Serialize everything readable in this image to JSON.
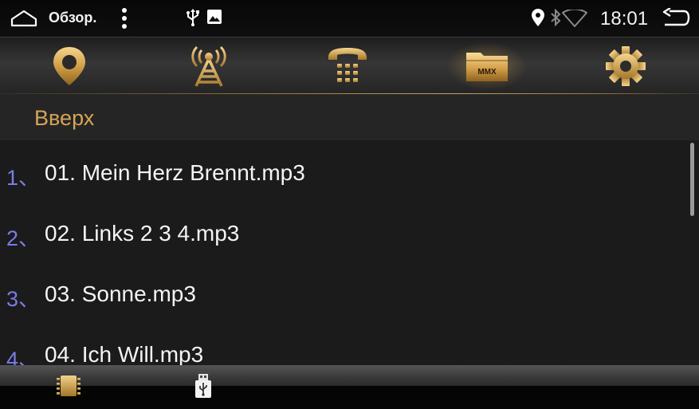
{
  "statusbar": {
    "title": "Обзор.",
    "time": "18:01",
    "icons": [
      "home-outline-icon",
      "more-vert-icon",
      "usb-icon",
      "image-icon",
      "location-icon",
      "bluetooth-icon",
      "wifi-icon",
      "back-icon"
    ]
  },
  "tabs": [
    {
      "name": "navigation",
      "icon": "map-pin-icon",
      "active": false
    },
    {
      "name": "radio",
      "icon": "radio-tower-icon",
      "active": false
    },
    {
      "name": "phone",
      "icon": "phone-icon",
      "active": false
    },
    {
      "name": "media",
      "icon": "folder-icon",
      "label": "MMX",
      "active": true
    },
    {
      "name": "settings",
      "icon": "gear-icon",
      "active": false
    }
  ],
  "list": {
    "up_label": "Вверх",
    "items": [
      {
        "index": "1、",
        "name": "01. Mein Herz Brennt.mp3"
      },
      {
        "index": "2、",
        "name": "02. Links 2 3 4.mp3"
      },
      {
        "index": "3、",
        "name": "03. Sonne.mp3"
      },
      {
        "index": "4、",
        "name": "04. Ich Will.mp3"
      }
    ]
  },
  "bottombar": {
    "buttons": [
      {
        "name": "sd-card",
        "icon": "sd-card-icon"
      },
      {
        "name": "usb-drive",
        "icon": "usb-drive-icon"
      }
    ]
  },
  "colors": {
    "accent_gold": "#d5a457",
    "index_purple": "#7b7ce6",
    "text_white": "#f4f4f4",
    "background": "#1b1b1b"
  }
}
